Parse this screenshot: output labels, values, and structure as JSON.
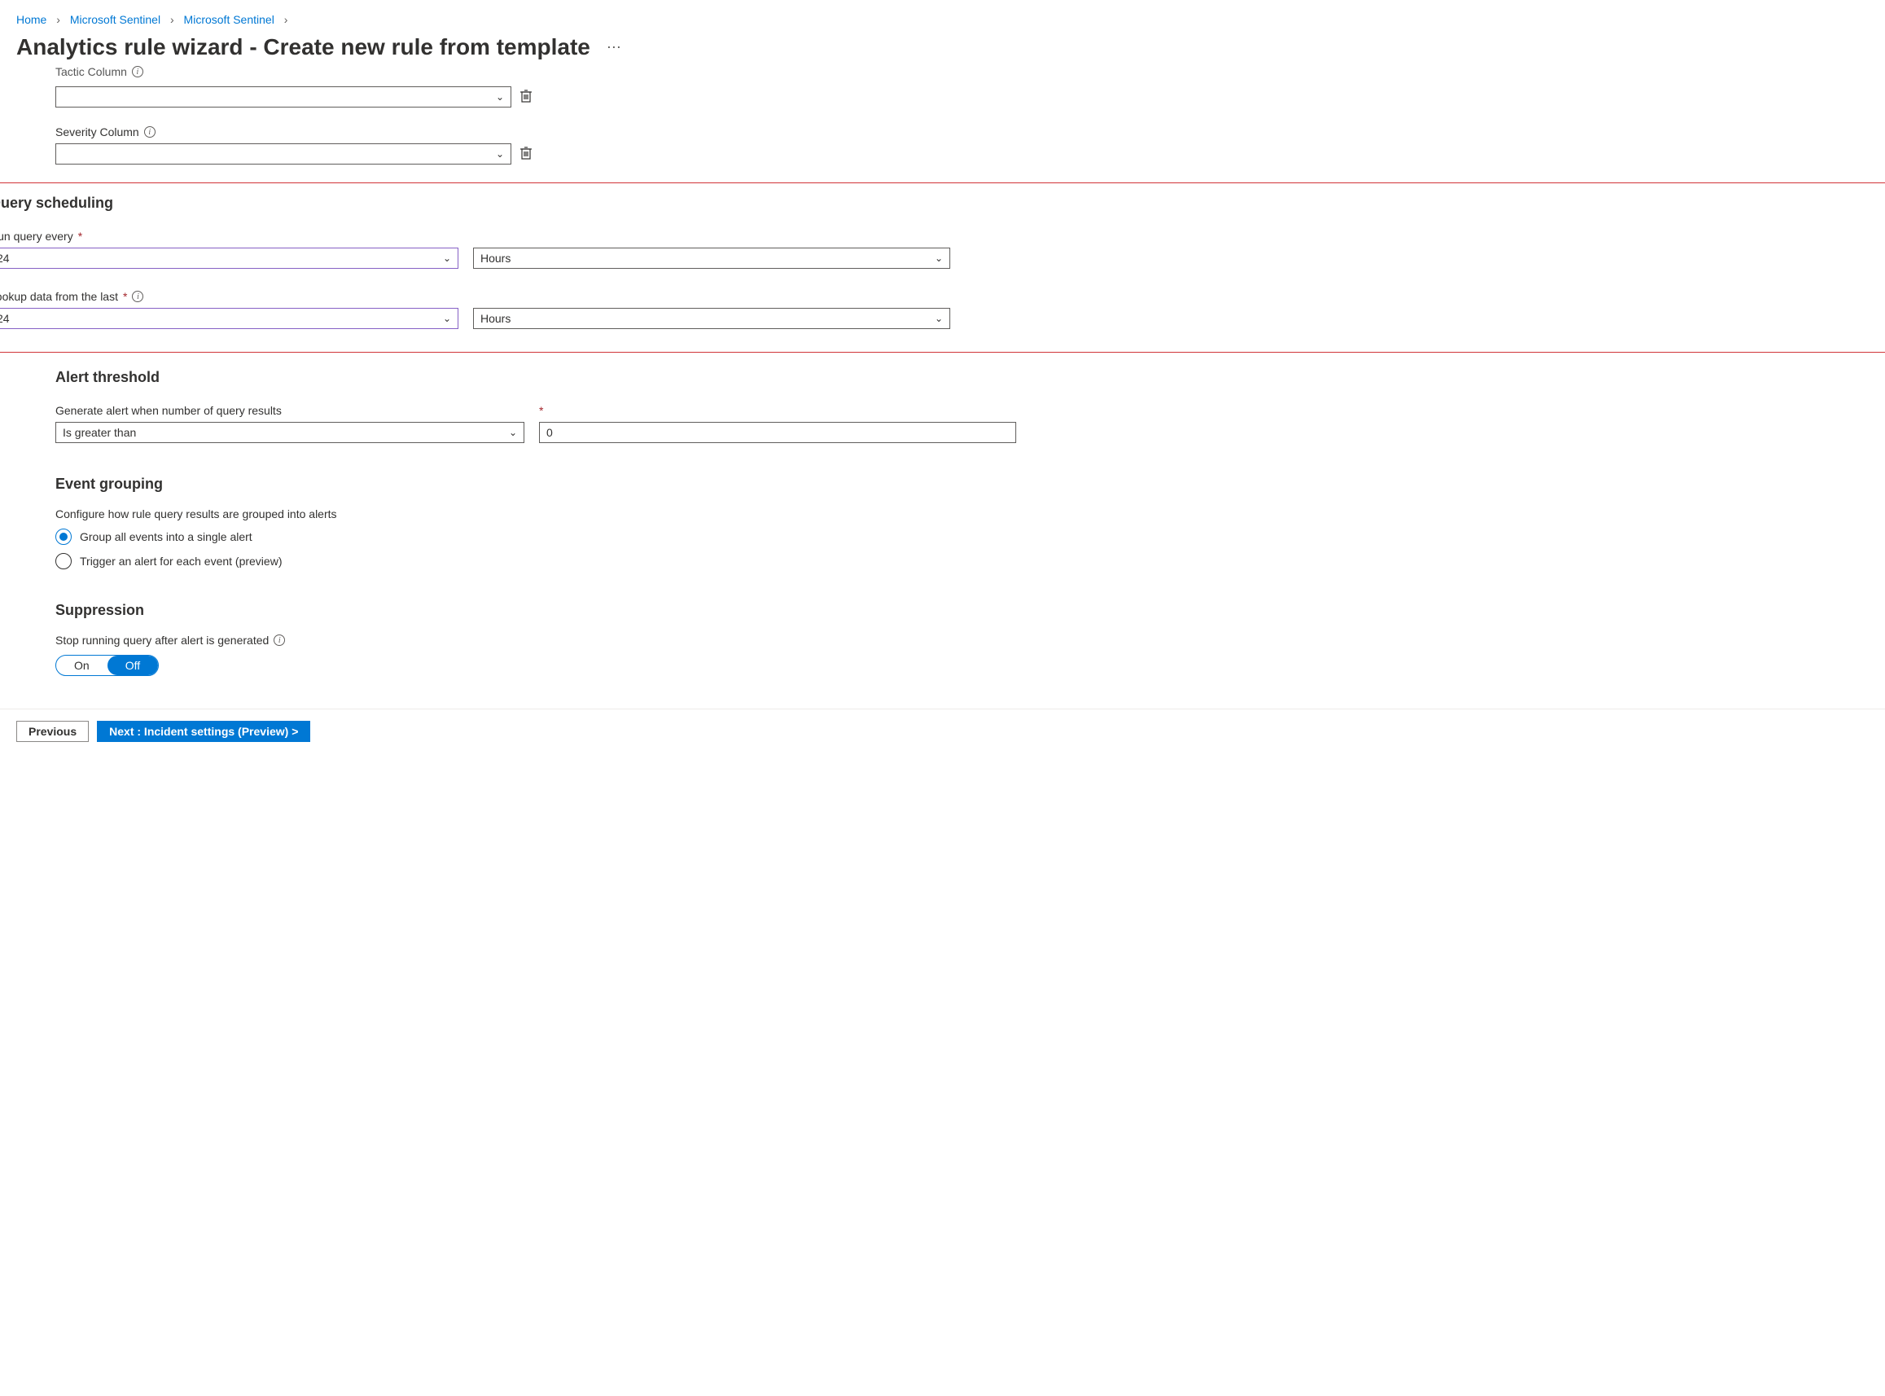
{
  "breadcrumb": {
    "items": [
      "Home",
      "Microsoft Sentinel",
      "Microsoft Sentinel"
    ]
  },
  "pageTitle": "Analytics rule wizard - Create new rule from template",
  "columns": {
    "tactic": {
      "label": "Tactic Column",
      "value": ""
    },
    "severity": {
      "label": "Severity Column",
      "value": ""
    }
  },
  "scheduling": {
    "heading": "Query scheduling",
    "runEvery": {
      "label": "Run query every",
      "value": "24",
      "unit": "Hours"
    },
    "lookup": {
      "label": "Lookup data from the last",
      "value": "24",
      "unit": "Hours"
    }
  },
  "threshold": {
    "heading": "Alert threshold",
    "label": "Generate alert when number of query results",
    "operator": "Is greater than",
    "value": "0"
  },
  "grouping": {
    "heading": "Event grouping",
    "desc": "Configure how rule query results are grouped into alerts",
    "opt1": "Group all events into a single alert",
    "opt2": "Trigger an alert for each event (preview)"
  },
  "suppression": {
    "heading": "Suppression",
    "label": "Stop running query after alert is generated",
    "on": "On",
    "off": "Off"
  },
  "footer": {
    "prev": "Previous",
    "next": "Next : Incident settings (Preview) >"
  }
}
